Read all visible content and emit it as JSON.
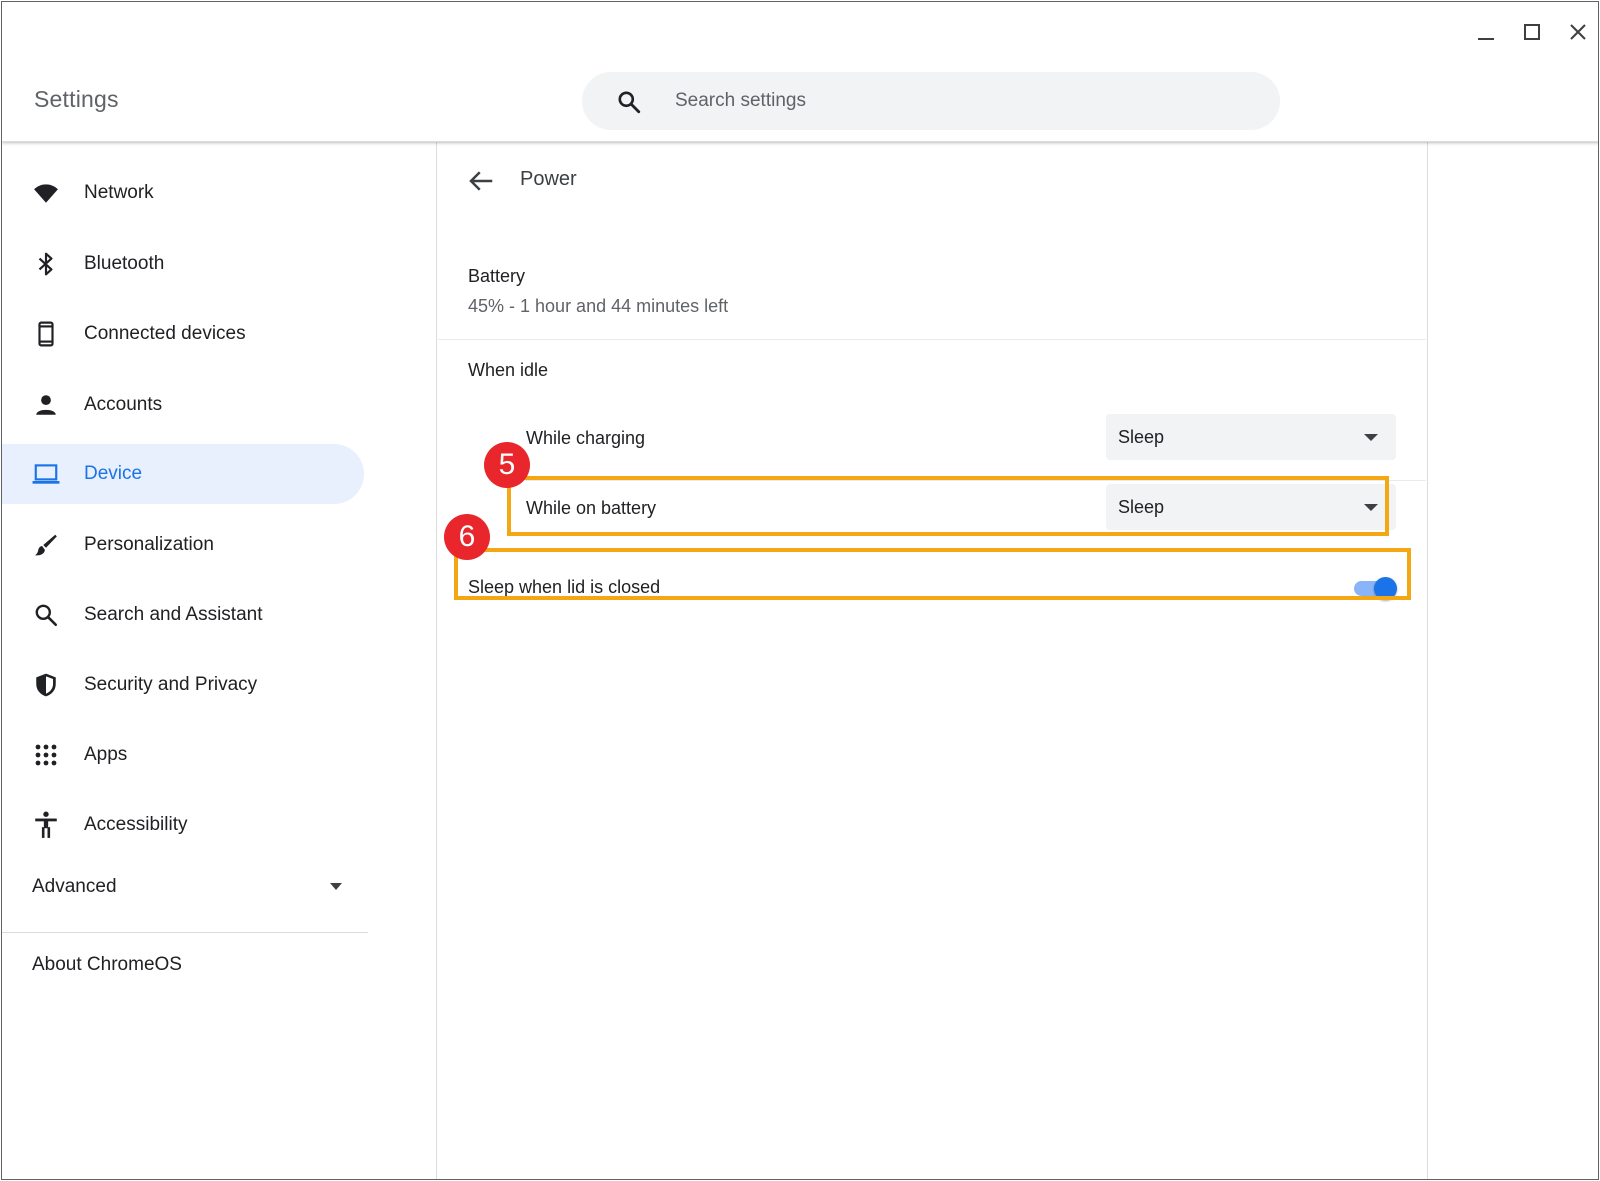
{
  "header": {
    "title": "Settings",
    "search_placeholder": "Search settings"
  },
  "sidebar": {
    "items": [
      {
        "label": "Network",
        "icon": "wifi-icon"
      },
      {
        "label": "Bluetooth",
        "icon": "bluetooth-icon"
      },
      {
        "label": "Connected devices",
        "icon": "phone-icon"
      },
      {
        "label": "Accounts",
        "icon": "person-icon"
      },
      {
        "label": "Device",
        "icon": "laptop-icon",
        "active": true
      },
      {
        "label": "Personalization",
        "icon": "brush-icon"
      },
      {
        "label": "Search and Assistant",
        "icon": "search-icon"
      },
      {
        "label": "Security and Privacy",
        "icon": "shield-icon"
      },
      {
        "label": "Apps",
        "icon": "apps-grid-icon"
      },
      {
        "label": "Accessibility",
        "icon": "accessibility-icon"
      }
    ],
    "advanced_label": "Advanced",
    "about_label": "About ChromeOS"
  },
  "power": {
    "title": "Power",
    "battery_label": "Battery",
    "battery_status": "45% - 1 hour and 44 minutes left",
    "idle_label": "When idle",
    "while_charging_label": "While charging",
    "while_charging_value": "Sleep",
    "while_on_battery_label": "While on battery",
    "while_on_battery_value": "Sleep",
    "lid_label": "Sleep when lid is closed",
    "lid_enabled": true
  },
  "annotations": {
    "badge_5": "5",
    "badge_6": "6",
    "highlight_color": "#f3a712",
    "badge_color": "#e8262c"
  },
  "colors": {
    "accent": "#1a73e8",
    "active_bg": "#e8f0fe"
  }
}
